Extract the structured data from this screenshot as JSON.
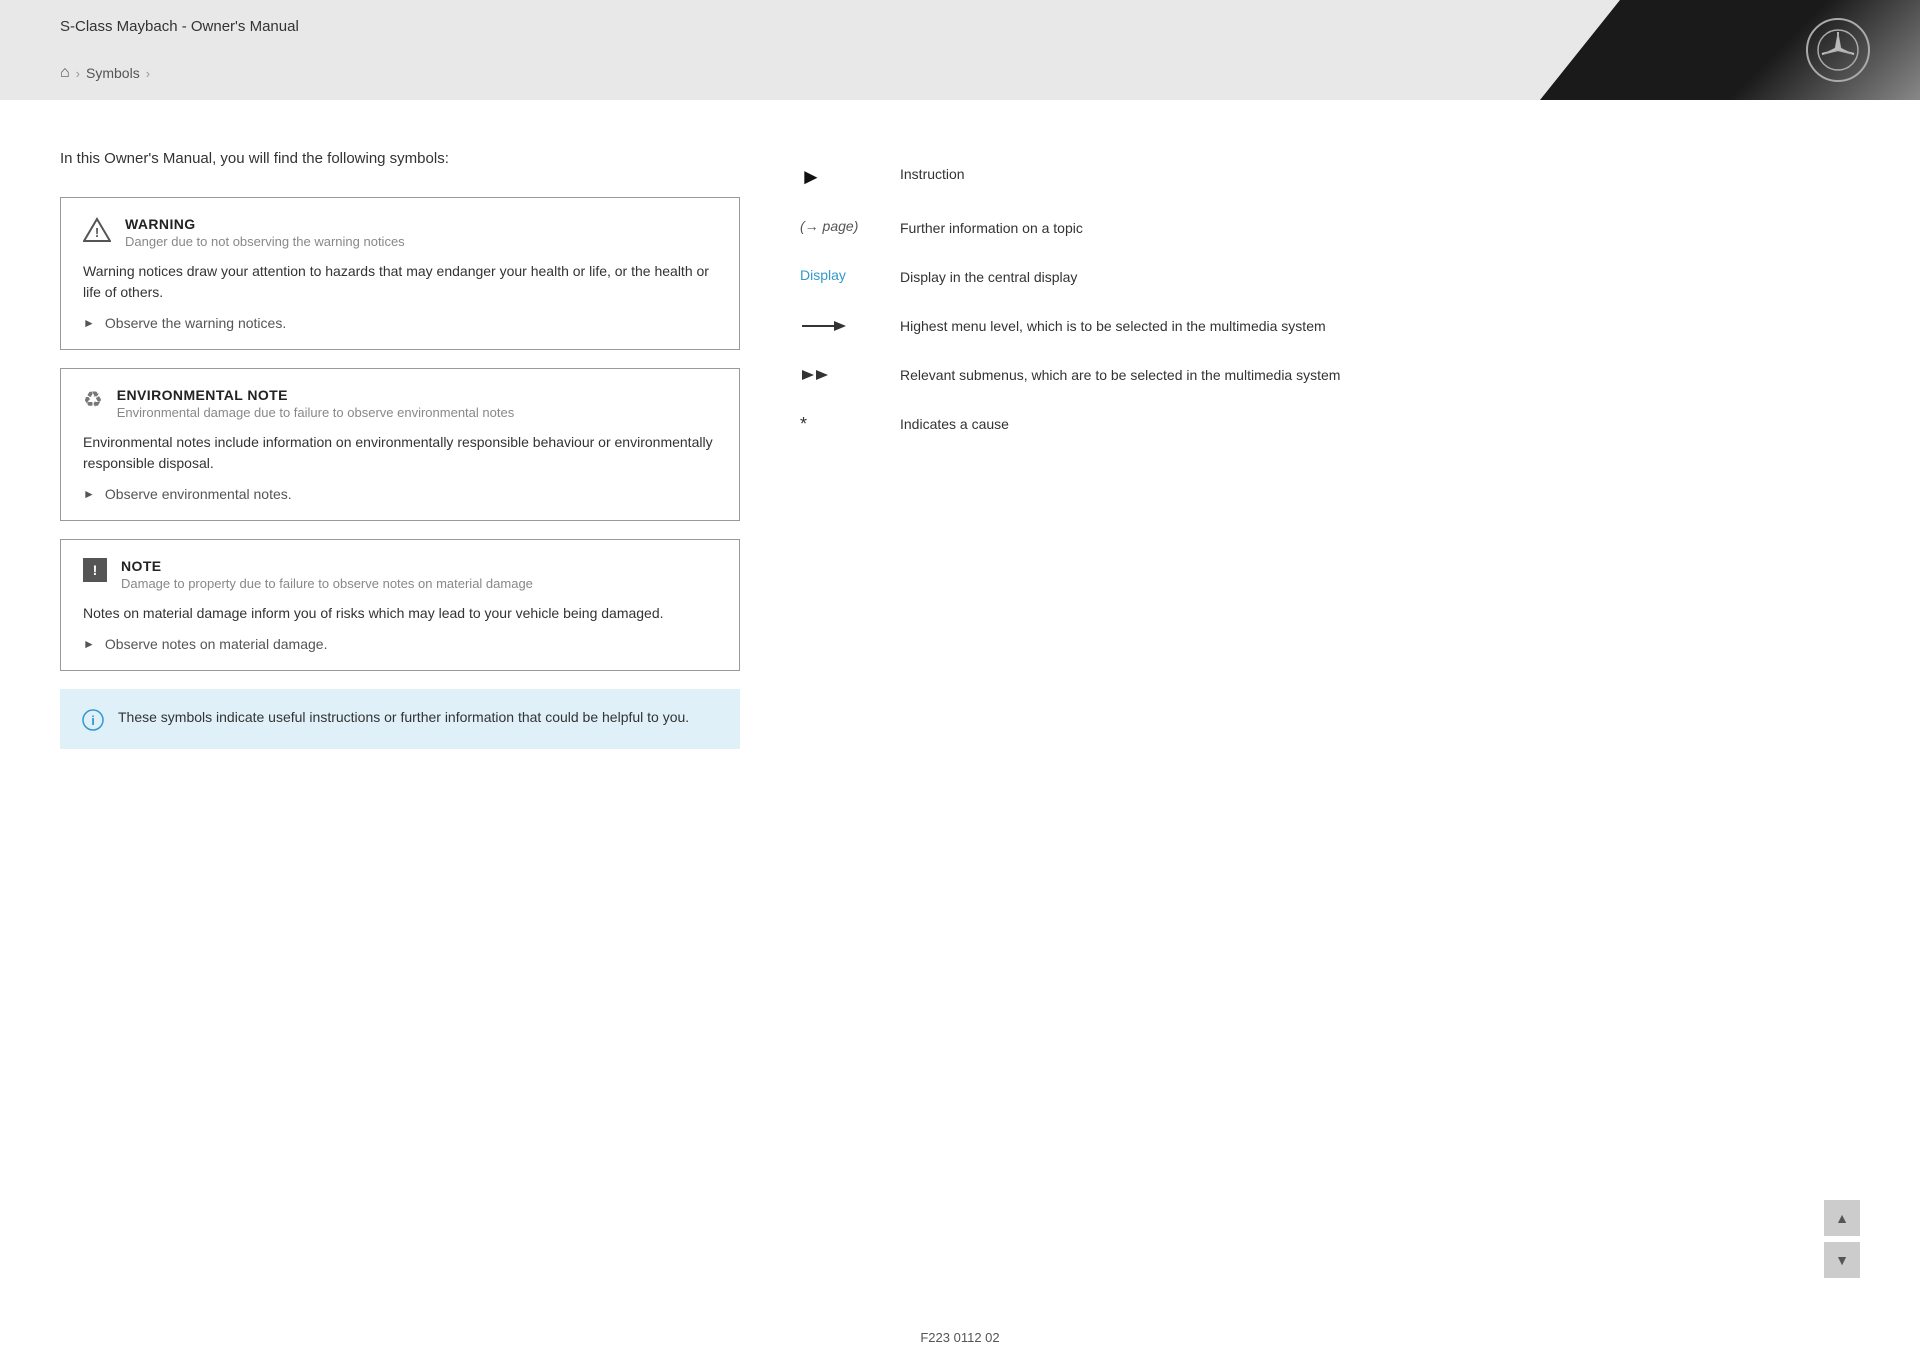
{
  "header": {
    "title": "S-Class Maybach - Owner's Manual",
    "breadcrumb": {
      "home_label": "⌂",
      "items": [
        "Symbols"
      ]
    }
  },
  "intro": {
    "text": "In this Owner's Manual, you will find the following symbols:"
  },
  "notices": [
    {
      "type": "warning",
      "title": "WARNING",
      "subtitle": "Danger due to not observing the warning notices",
      "body": "Warning notices draw your attention to hazards that may endanger your health or life, or the health or life of others.",
      "instruction": "Observe the warning notices."
    },
    {
      "type": "environmental",
      "title": "ENVIRONMENTAL NOTE",
      "subtitle": "Environmental damage due to failure to observe environmental notes",
      "body": "Environmental notes include information on environmentally responsible behaviour or environmentally responsible disposal.",
      "instruction": "Observe environmental notes."
    },
    {
      "type": "note",
      "title": "NOTE",
      "subtitle": "Damage to property due to failure to observe notes on material damage",
      "body": "Notes on material damage inform you of risks which may lead to your vehicle being damaged.",
      "instruction": "Observe notes on material damage."
    }
  ],
  "info_box": {
    "text": "These symbols indicate useful instructions or further information that could be helpful to you."
  },
  "symbols": [
    {
      "icon_type": "play-arrow",
      "label": "Instruction"
    },
    {
      "icon_type": "page-ref",
      "icon_text": "(→ page)",
      "label": "Further information on a topic"
    },
    {
      "icon_type": "display",
      "icon_text": "Display",
      "label": "Display in the central display"
    },
    {
      "icon_type": "nav-arrow",
      "label": "Highest menu level, which is to be selected in the multimedia system"
    },
    {
      "icon_type": "double-arrow",
      "label": "Relevant submenus, which are to be selected in the multimedia system"
    },
    {
      "icon_type": "asterisk",
      "icon_text": "*",
      "label": "Indicates a cause"
    }
  ],
  "footer": {
    "code": "F223 0112 02"
  },
  "scroll": {
    "up_label": "▲",
    "down_label": "▼"
  }
}
